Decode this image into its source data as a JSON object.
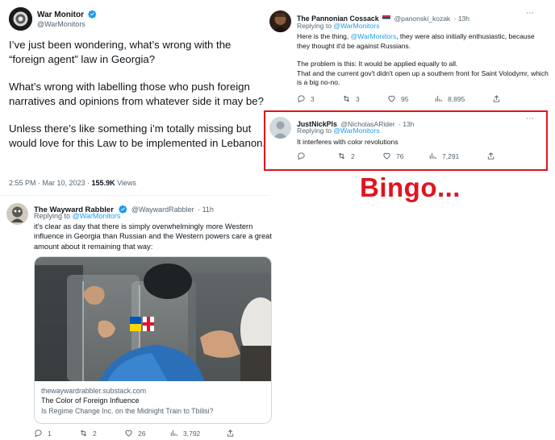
{
  "main_tweet": {
    "name": "War Monitor",
    "handle": "@WarMonitors",
    "paragraphs": [
      "I’ve just been wondering, what’s wrong with the “foreign agent” law in Georgia?",
      "What’s wrong with labelling those who push foreign narratives and opinions from whatever side it may be?",
      "Unless there’s like something i’m totally missing but would love for this Law to be implemented in Lebanon."
    ],
    "time": "2:55 PM · Mar 10, 2023 · ",
    "views": "155.9K",
    "views_label": " Views"
  },
  "reply_rabbler": {
    "name": "The Wayward Rabbler",
    "handle": "@WaywardRabbler",
    "age": "· 11h",
    "replying_prefix": "Replying to ",
    "replying_to": "@WarMonitors",
    "text": "it's clear as day that there is simply overwhelmingly more Western influence in Georgia than Russian and the Western powers care a great amount about it remaining that way:",
    "card": {
      "domain": "thewaywardrabbler.substack.com",
      "title": "The Color of Foreign Influence",
      "subtitle": "Is Regime Change Inc. on the Midnight Train to Tbilisi?"
    },
    "stats": {
      "replies": "1",
      "retweets": "2",
      "likes": "26",
      "views": "3,792"
    }
  },
  "reply_cossack": {
    "name": "The Pannonian Cossack",
    "flag": "🇷🇸",
    "handle": "@panonski_kozak",
    "age": "· 13h",
    "replying_prefix": "Replying to ",
    "replying_to": "@WarMonitors",
    "line1_a": "Here is the thing, ",
    "line1_link": "@WarMonitors",
    "line1_b": ", they were also initially enthusiastic, because they thought it'd be against Russians.",
    "line2": "The problem is this: It would be applied equally to all.",
    "line3": "That and the current gov't didn't open up a southern front for Saint Volodymr, which is a big no-no.",
    "stats": {
      "replies": "3",
      "retweets": "3",
      "likes": "95",
      "views": "8,895"
    }
  },
  "reply_nick": {
    "name": "JustNickPls",
    "handle": "@NicholasARider",
    "age": "· 13h",
    "replying_prefix": "Replying to ",
    "replying_to": "@WarMonitors",
    "text": "It interferes with color revolutions",
    "stats": {
      "replies": "",
      "retweets": "2",
      "likes": "76",
      "views": "7,291"
    }
  },
  "annotation": {
    "text": "Bingo..."
  },
  "colors": {
    "accent": "#1d9bf0",
    "highlight_box": "#e0141e",
    "annotation": "#e0141e"
  }
}
